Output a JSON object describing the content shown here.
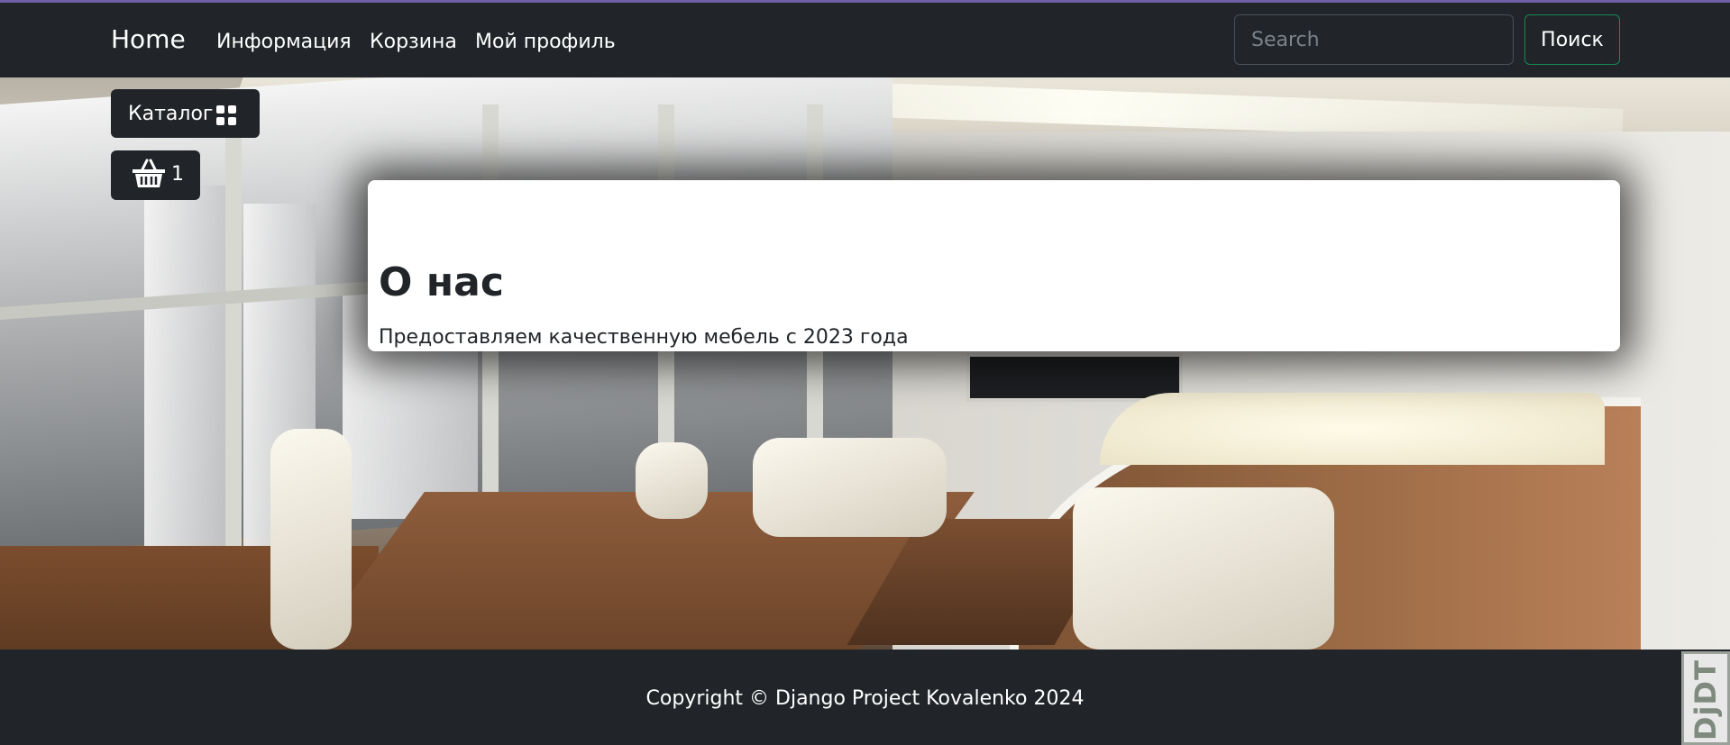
{
  "navbar": {
    "brand": "Home",
    "links": [
      "Информация",
      "Корзина",
      "Мой профиль"
    ],
    "search": {
      "placeholder": "Search",
      "button_label": "Поиск"
    },
    "accent_color": "#6f5fa8"
  },
  "side_buttons": {
    "catalog_label": "Каталог",
    "catalog_icon": "grid-icon",
    "cart_icon": "basket-icon",
    "cart_count": "1"
  },
  "about": {
    "title": "О нас",
    "text": "Предоставляем качественную мебель с 2023 года"
  },
  "footer": {
    "copyright": "Copyright © Django Project Kovalenko 2024"
  },
  "debug_toolbar": {
    "label": "DjDT"
  },
  "colors": {
    "dark": "#212529",
    "search_button_border": "#198754"
  }
}
